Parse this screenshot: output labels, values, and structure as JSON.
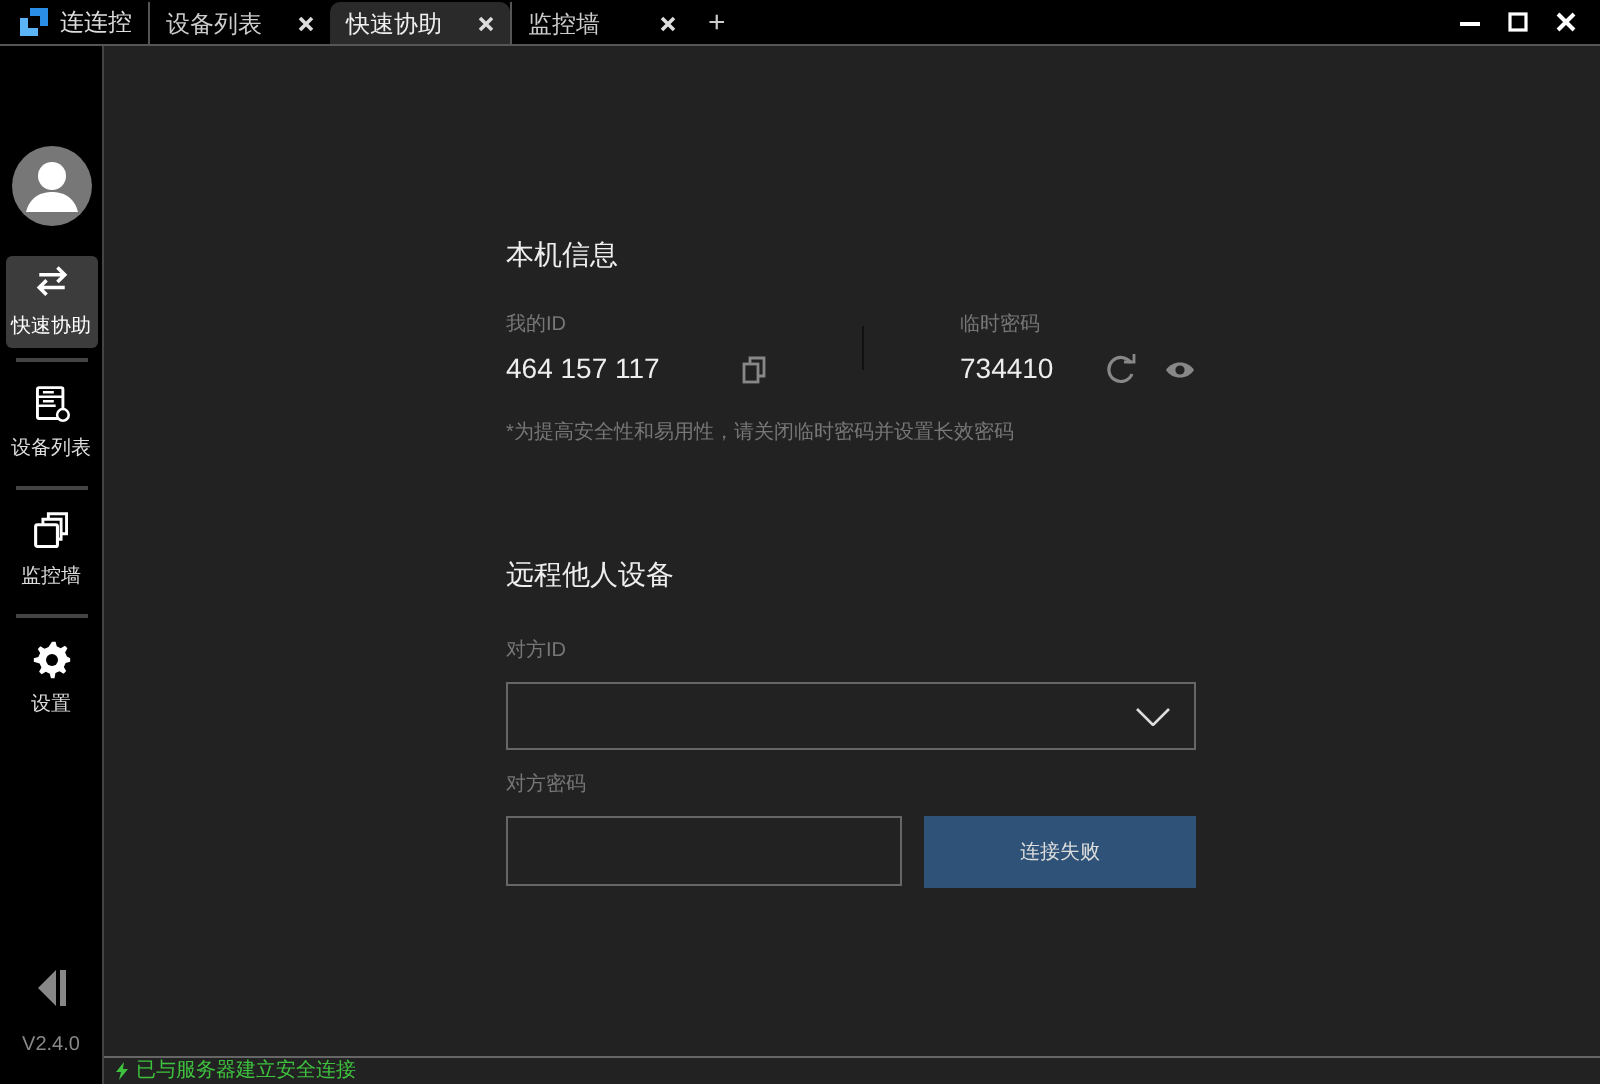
{
  "app": {
    "title": "连连控"
  },
  "tabs": [
    {
      "label": "设备列表",
      "selected": false,
      "closable": true
    },
    {
      "label": "快速协助",
      "selected": true,
      "closable": true
    },
    {
      "label": "监控墙",
      "selected": false,
      "closable": true
    }
  ],
  "new_tab": "+",
  "sidebar": {
    "items": [
      {
        "kind": "swap",
        "label": "快速协助",
        "selected": true
      },
      {
        "kind": "devices",
        "label": "设备列表",
        "selected": false
      },
      {
        "kind": "wall",
        "label": "监控墙",
        "selected": false
      },
      {
        "kind": "settings",
        "label": "设置",
        "selected": false
      }
    ],
    "version": "V2.4.0"
  },
  "local_info": {
    "heading": "本机信息",
    "id_label": "我的ID",
    "id_value": "464 157 117",
    "password_label": "临时密码",
    "password_value": "734410",
    "note": "*为提高安全性和易用性，请关闭临时密码并设置长效密码"
  },
  "remote": {
    "heading": "远程他人设备",
    "id_label": "对方ID",
    "password_label": "对方密码",
    "connect_button": "连接失败"
  },
  "status_bar": {
    "text": "已与服务器建立安全连接"
  }
}
